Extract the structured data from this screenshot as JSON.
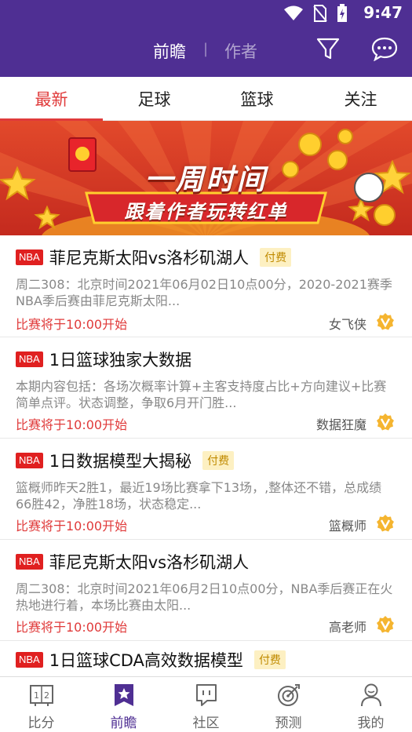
{
  "status_bar": {
    "time": "9:47"
  },
  "header": {
    "tabs": [
      {
        "label": "前瞻",
        "active": true
      },
      {
        "label": "作者",
        "active": false
      }
    ],
    "separator": "|",
    "accent": "#4f2f93"
  },
  "sport_tabs": [
    {
      "label": "最新",
      "active": true
    },
    {
      "label": "足球",
      "active": false
    },
    {
      "label": "篮球",
      "active": false
    },
    {
      "label": "关注",
      "active": false
    }
  ],
  "banner": {
    "title": "一周时间",
    "subtitle": "跟着作者玩转红单"
  },
  "articles": [
    {
      "league": "NBA",
      "title": "菲尼克斯太阳vs洛杉矶湖人",
      "paid_label": "付费",
      "description": "周二308：北京时间2021年06月02日10点00分，2020-2021赛季NBA季后赛由菲尼克斯太阳...",
      "start_text": "比赛将于10:00开始",
      "author": "女飞侠"
    },
    {
      "league": "NBA",
      "title": "1日篮球独家大数据",
      "paid_label": "",
      "description": "本期内容包括：各场次概率计算+主客支持度占比+方向建议+比赛简单点评。状态调整，争取6月开门胜...",
      "start_text": "比赛将于10:00开始",
      "author": "数据狂魔"
    },
    {
      "league": "NBA",
      "title": "1日数据模型大揭秘",
      "paid_label": "付费",
      "description": "篮概师昨天2胜1，最近19场比赛拿下13场，,整体还不错，总成绩66胜42，净胜18场，状态稳定...",
      "start_text": "比赛将于10:00开始",
      "author": "篮概师"
    },
    {
      "league": "NBA",
      "title": "菲尼克斯太阳vs洛杉矶湖人",
      "paid_label": "",
      "description": "周二308：北京时间2021年06月2日10点00分，NBA季后赛正在火热地进行着，本场比赛由太阳...",
      "start_text": "比赛将于10:00开始",
      "author": "高老师"
    },
    {
      "league": "NBA",
      "title": "1日篮球CDA高效数据模型",
      "paid_label": "付费",
      "description": "",
      "start_text": "",
      "author": ""
    }
  ],
  "bottom_nav": [
    {
      "label": "比分",
      "icon": "scoreboard-icon",
      "active": false
    },
    {
      "label": "前瞻",
      "icon": "star-bookmark-icon",
      "active": true
    },
    {
      "label": "社区",
      "icon": "community-chat-icon",
      "active": false
    },
    {
      "label": "预测",
      "icon": "target-icon",
      "active": false
    },
    {
      "label": "我的",
      "icon": "person-icon",
      "active": false
    }
  ]
}
